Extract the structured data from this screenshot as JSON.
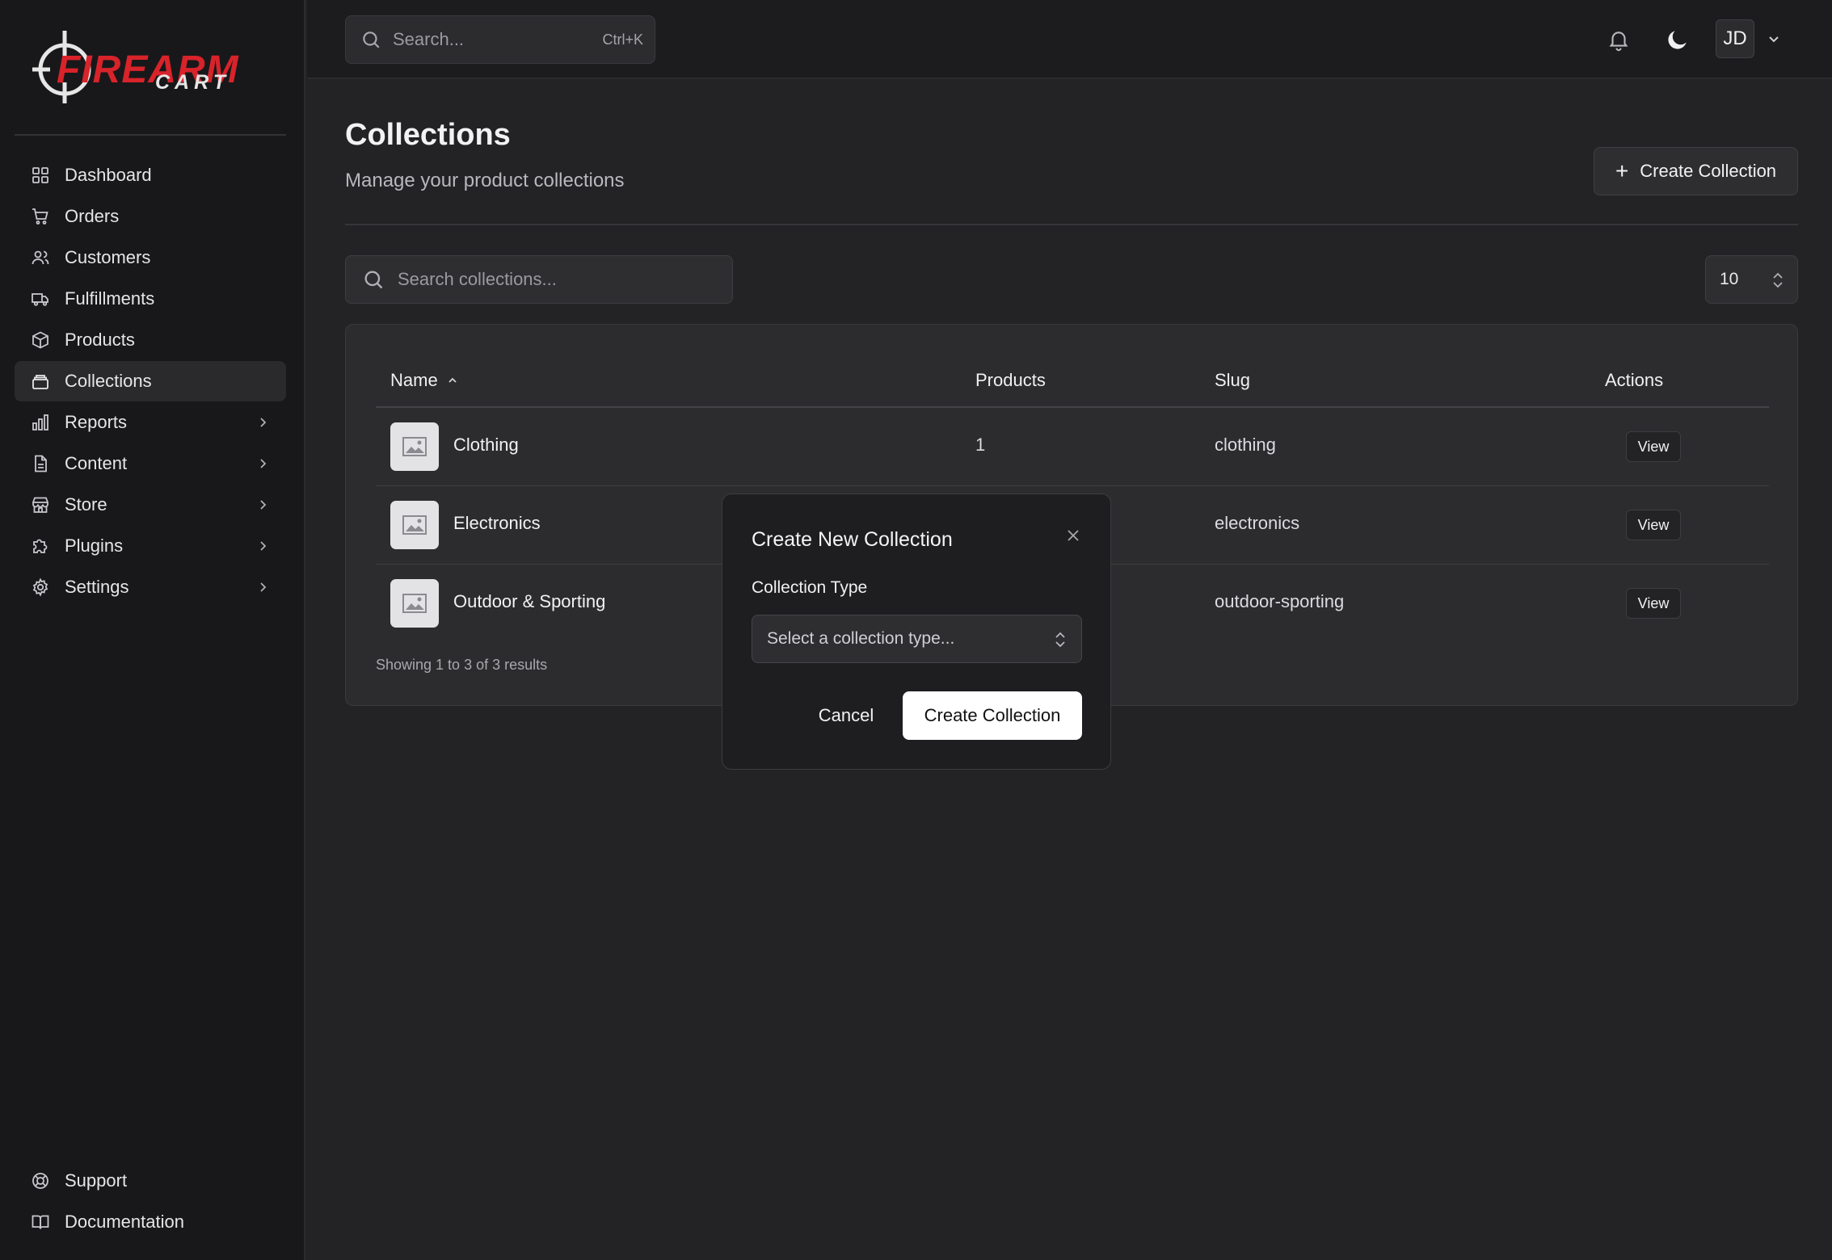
{
  "brand": {
    "logo_word_1": "FIREARM",
    "logo_word_2": "CART",
    "accent_color": "#d8232a"
  },
  "sidebar": {
    "items": [
      {
        "label": "Dashboard",
        "icon": "grid-icon"
      },
      {
        "label": "Orders",
        "icon": "cart-icon"
      },
      {
        "label": "Customers",
        "icon": "users-icon"
      },
      {
        "label": "Fulfillments",
        "icon": "truck-icon"
      },
      {
        "label": "Products",
        "icon": "box-icon"
      },
      {
        "label": "Collections",
        "icon": "collection-icon",
        "active": true
      },
      {
        "label": "Reports",
        "icon": "bar-chart-icon",
        "expandable": true
      },
      {
        "label": "Content",
        "icon": "file-icon",
        "expandable": true
      },
      {
        "label": "Store",
        "icon": "store-icon",
        "expandable": true
      },
      {
        "label": "Plugins",
        "icon": "puzzle-icon",
        "expandable": true
      },
      {
        "label": "Settings",
        "icon": "gear-icon",
        "expandable": true
      }
    ],
    "bottom": [
      {
        "label": "Support",
        "icon": "lifebuoy-icon"
      },
      {
        "label": "Documentation",
        "icon": "book-icon"
      }
    ]
  },
  "topbar": {
    "search_placeholder": "Search...",
    "search_shortcut": "Ctrl+K",
    "avatar_initials": "JD"
  },
  "page": {
    "title": "Collections",
    "subtitle": "Manage your product collections",
    "create_button": "Create Collection",
    "search_placeholder": "Search collections...",
    "per_page": "10"
  },
  "table": {
    "headers": {
      "name": "Name",
      "products": "Products",
      "slug": "Slug",
      "actions": "Actions"
    },
    "rows": [
      {
        "name": "Clothing",
        "products": "1",
        "slug": "clothing",
        "action": "View"
      },
      {
        "name": "Electronics",
        "products": "",
        "slug": "electronics",
        "action": "View"
      },
      {
        "name": "Outdoor & Sporting",
        "products": "",
        "slug": "outdoor-sporting",
        "action": "View"
      }
    ],
    "results_text": "Showing 1 to 3 of 3 results"
  },
  "modal": {
    "title": "Create New Collection",
    "field_label": "Collection Type",
    "select_placeholder": "Select a collection type...",
    "cancel": "Cancel",
    "submit": "Create Collection"
  }
}
